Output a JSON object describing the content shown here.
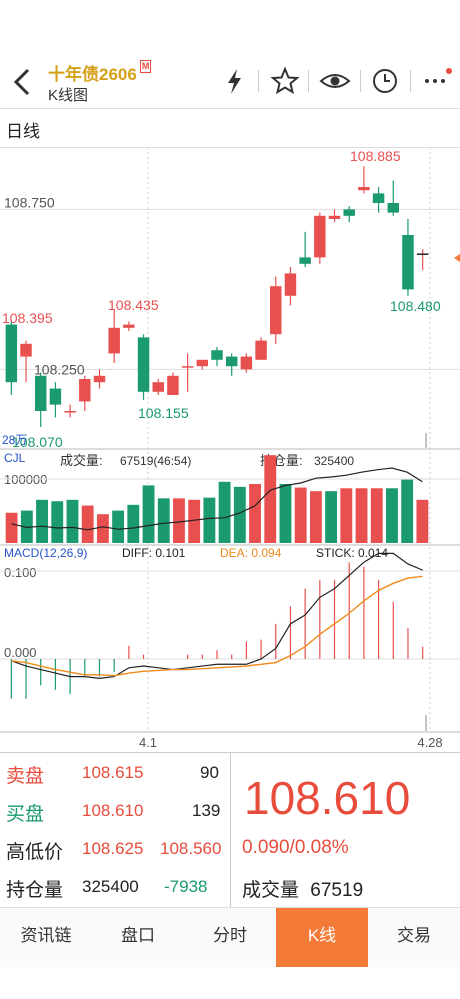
{
  "header": {
    "title": "十年债2606",
    "badge": "M",
    "subtitle": "K线图",
    "icons": [
      "back-icon",
      "lightning-icon",
      "star-icon",
      "eye-icon",
      "clock-icon",
      "more-icon"
    ]
  },
  "period_tab": "日线",
  "price_labels": {
    "max": "108.885",
    "level_high": "108.750",
    "left_high": "108.395",
    "mid_high": "108.435",
    "level_low": "108.250",
    "mid_low": "108.155",
    "left_low": "108.070",
    "right_low": "108.480"
  },
  "volume_panel": {
    "name": "CJL",
    "vol_label": "成交量:",
    "vol_value": "67519(46:54)",
    "oi_label": "持仓量:",
    "oi_value": "325400",
    "axis_top": "100000",
    "axis_unit": "28万"
  },
  "macd_panel": {
    "name": "MACD(12,26,9)",
    "diff": "DIFF: 0.101",
    "dea": "DEA: 0.094",
    "stick": "STICK: 0.014",
    "axis_top": "0.100",
    "axis_zero": "0.000"
  },
  "x_axis": {
    "left": "4.1",
    "right": "4.28"
  },
  "colors": {
    "up": "#e85050",
    "down": "#1a9a6e",
    "dea": "#f08a1c",
    "diff": "#222222",
    "accent": "#f47a37"
  },
  "chart_data": {
    "type": "candlestick",
    "candles": [
      {
        "o": 108.39,
        "c": 108.21,
        "h": 108.4,
        "l": 108.17
      },
      {
        "o": 108.29,
        "c": 108.33,
        "h": 108.34,
        "l": 108.21
      },
      {
        "o": 108.23,
        "c": 108.12,
        "h": 108.24,
        "l": 108.07
      },
      {
        "o": 108.19,
        "c": 108.14,
        "h": 108.21,
        "l": 108.1
      },
      {
        "o": 108.12,
        "c": 108.12,
        "h": 108.14,
        "l": 108.1
      },
      {
        "o": 108.15,
        "c": 108.22,
        "h": 108.23,
        "l": 108.12
      },
      {
        "o": 108.21,
        "c": 108.23,
        "h": 108.25,
        "l": 108.19
      },
      {
        "o": 108.3,
        "c": 108.38,
        "h": 108.435,
        "l": 108.27
      },
      {
        "o": 108.38,
        "c": 108.39,
        "h": 108.4,
        "l": 108.37
      },
      {
        "o": 108.35,
        "c": 108.18,
        "h": 108.36,
        "l": 108.155
      },
      {
        "o": 108.18,
        "c": 108.21,
        "h": 108.22,
        "l": 108.17
      },
      {
        "o": 108.17,
        "c": 108.23,
        "h": 108.24,
        "l": 108.17
      },
      {
        "o": 108.26,
        "c": 108.26,
        "h": 108.3,
        "l": 108.18
      },
      {
        "o": 108.26,
        "c": 108.28,
        "h": 108.28,
        "l": 108.25
      },
      {
        "o": 108.31,
        "c": 108.28,
        "h": 108.32,
        "l": 108.26
      },
      {
        "o": 108.29,
        "c": 108.26,
        "h": 108.3,
        "l": 108.23
      },
      {
        "o": 108.25,
        "c": 108.29,
        "h": 108.3,
        "l": 108.24
      },
      {
        "o": 108.28,
        "c": 108.34,
        "h": 108.35,
        "l": 108.28
      },
      {
        "o": 108.36,
        "c": 108.51,
        "h": 108.54,
        "l": 108.33
      },
      {
        "o": 108.48,
        "c": 108.55,
        "h": 108.57,
        "l": 108.45
      },
      {
        "o": 108.6,
        "c": 108.58,
        "h": 108.68,
        "l": 108.57
      },
      {
        "o": 108.6,
        "c": 108.73,
        "h": 108.74,
        "l": 108.58
      },
      {
        "o": 108.72,
        "c": 108.73,
        "h": 108.75,
        "l": 108.71
      },
      {
        "o": 108.75,
        "c": 108.73,
        "h": 108.76,
        "l": 108.71
      },
      {
        "o": 108.81,
        "c": 108.82,
        "h": 108.885,
        "l": 108.8
      },
      {
        "o": 108.8,
        "c": 108.77,
        "h": 108.82,
        "l": 108.74
      },
      {
        "o": 108.77,
        "c": 108.74,
        "h": 108.84,
        "l": 108.73
      },
      {
        "o": 108.67,
        "c": 108.5,
        "h": 108.72,
        "l": 108.48
      },
      {
        "o": 108.61,
        "c": 108.61,
        "h": 108.625,
        "l": 108.56
      }
    ],
    "volume": [
      {
        "v": 0.42,
        "up": true
      },
      {
        "v": 0.45,
        "up": false
      },
      {
        "v": 0.6,
        "up": false
      },
      {
        "v": 0.58,
        "up": false
      },
      {
        "v": 0.6,
        "up": false
      },
      {
        "v": 0.52,
        "up": true
      },
      {
        "v": 0.4,
        "up": true
      },
      {
        "v": 0.45,
        "up": false
      },
      {
        "v": 0.53,
        "up": false
      },
      {
        "v": 0.8,
        "up": false
      },
      {
        "v": 0.62,
        "up": false
      },
      {
        "v": 0.62,
        "up": true
      },
      {
        "v": 0.6,
        "up": true
      },
      {
        "v": 0.63,
        "up": false
      },
      {
        "v": 0.85,
        "up": false
      },
      {
        "v": 0.78,
        "up": false
      },
      {
        "v": 0.82,
        "up": true
      },
      {
        "v": 1.22,
        "up": true
      },
      {
        "v": 0.82,
        "up": false
      },
      {
        "v": 0.77,
        "up": true
      },
      {
        "v": 0.72,
        "up": true
      },
      {
        "v": 0.72,
        "up": false
      },
      {
        "v": 0.76,
        "up": true
      },
      {
        "v": 0.76,
        "up": true
      },
      {
        "v": 0.76,
        "up": true
      },
      {
        "v": 0.76,
        "up": false
      },
      {
        "v": 0.88,
        "up": false
      },
      {
        "v": 0.6,
        "up": true
      }
    ],
    "open_interest": [
      0.32,
      0.26,
      0.28,
      0.25,
      0.26,
      0.22,
      0.27,
      0.23,
      0.25,
      0.29,
      0.33,
      0.35,
      0.38,
      0.41,
      0.42,
      0.5,
      0.62,
      0.88,
      0.96,
      1.0,
      1.08,
      1.1,
      1.13,
      1.18,
      1.22,
      1.25,
      1.18,
      1.02
    ],
    "macd_diff": [
      -0.002,
      -0.008,
      -0.012,
      -0.016,
      -0.02,
      -0.02,
      -0.022,
      -0.02,
      -0.01,
      -0.008,
      -0.01,
      -0.012,
      -0.01,
      -0.008,
      -0.006,
      -0.006,
      -0.006,
      0.0,
      0.012,
      0.04,
      0.05,
      0.07,
      0.08,
      0.095,
      0.11,
      0.12,
      0.12,
      0.108,
      0.101
    ],
    "macd_dea": [
      -0.002,
      -0.004,
      -0.008,
      -0.012,
      -0.015,
      -0.018,
      -0.018,
      -0.019,
      -0.016,
      -0.014,
      -0.013,
      -0.012,
      -0.012,
      -0.011,
      -0.01,
      -0.009,
      -0.008,
      -0.006,
      -0.004,
      0.004,
      0.014,
      0.028,
      0.04,
      0.052,
      0.066,
      0.078,
      0.086,
      0.092,
      0.094
    ],
    "macd_stick": [
      -0.045,
      -0.045,
      -0.03,
      -0.035,
      -0.04,
      -0.02,
      -0.02,
      -0.015,
      0.015,
      0.005,
      0.0,
      0.0,
      0.005,
      0.005,
      0.01,
      0.005,
      0.02,
      0.022,
      0.04,
      0.06,
      0.08,
      0.09,
      0.09,
      0.11,
      0.105,
      0.09,
      0.065,
      0.035,
      0.014
    ],
    "ylim": [
      108.02,
      108.92
    ]
  },
  "quote": {
    "ask_label": "卖盘",
    "ask_price": "108.615",
    "ask_qty": "90",
    "bid_label": "买盘",
    "bid_price": "108.610",
    "bid_qty": "139",
    "hl_label": "高低价",
    "high": "108.625",
    "low": "108.560",
    "oi_label": "持仓量",
    "oi": "325400",
    "oi_chg": "-7938",
    "last": "108.610",
    "change": "0.090/0.08%",
    "vol_label": "成交量",
    "vol": "67519"
  },
  "nav": [
    "资讯链",
    "盘口",
    "分时",
    "K线",
    "交易"
  ]
}
